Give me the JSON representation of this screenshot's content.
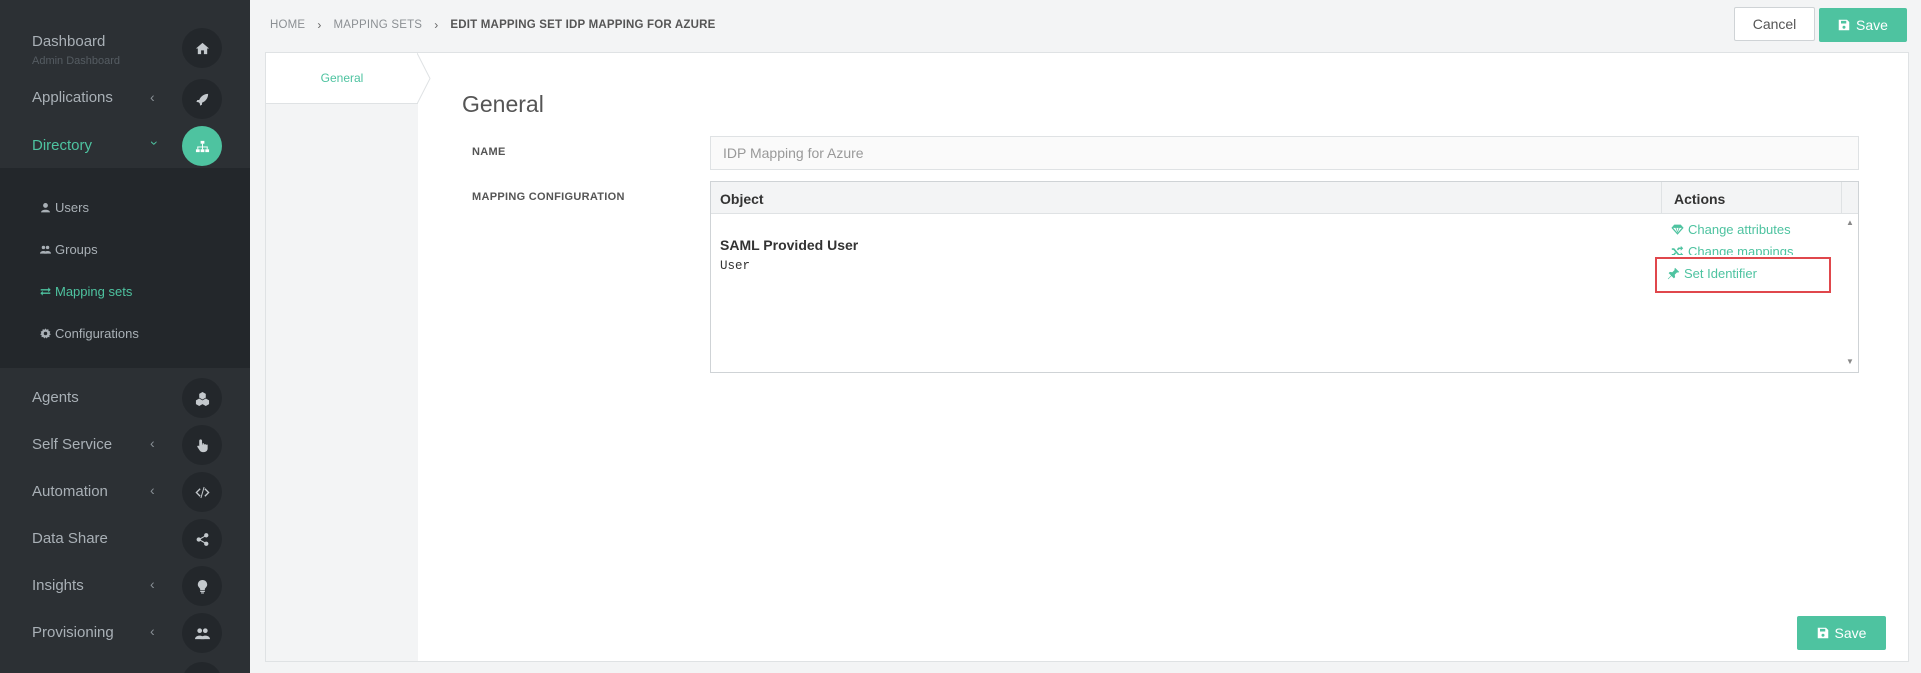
{
  "sidebar": {
    "dashboard": {
      "label": "Dashboard",
      "sub": "Admin Dashboard",
      "icon": "home-icon"
    },
    "applications": {
      "label": "Applications",
      "icon": "rocket-icon"
    },
    "directory": {
      "label": "Directory",
      "icon": "sitemap-icon",
      "items": [
        {
          "label": "Users",
          "icon": "user-icon"
        },
        {
          "label": "Groups",
          "icon": "users-icon"
        },
        {
          "label": "Mapping sets",
          "icon": "exchange-icon"
        },
        {
          "label": "Configurations",
          "icon": "gear-icon"
        }
      ]
    },
    "agents": {
      "label": "Agents",
      "icon": "cubes-icon"
    },
    "self_service": {
      "label": "Self Service",
      "icon": "hand-pointer-icon"
    },
    "automation": {
      "label": "Automation",
      "icon": "code-icon"
    },
    "data_share": {
      "label": "Data Share",
      "icon": "share-icon"
    },
    "insights": {
      "label": "Insights",
      "icon": "lightbulb-icon"
    },
    "provisioning": {
      "label": "Provisioning",
      "icon": "users-icon"
    }
  },
  "breadcrumb": {
    "home": "HOME",
    "mapping_sets": "MAPPING SETS",
    "current": "EDIT MAPPING SET IDP MAPPING FOR AZURE"
  },
  "toolbar": {
    "cancel": "Cancel",
    "save": "Save"
  },
  "tabs": {
    "general": "General"
  },
  "form": {
    "section_title": "General",
    "name_label": "NAME",
    "name_value": "IDP Mapping for Azure",
    "mapping_label": "MAPPING CONFIGURATION"
  },
  "table": {
    "headers": {
      "object": "Object",
      "actions": "Actions"
    },
    "rows": [
      {
        "object_name": "SAML Provided User",
        "object_type": "User",
        "actions": [
          "Change attributes",
          "Change mappings",
          "Set Identifier"
        ]
      }
    ]
  },
  "footer": {
    "save": "Save"
  },
  "colors": {
    "accent": "#4ec3a0",
    "sidebar": "#2c3034",
    "highlight": "#e0474c"
  }
}
